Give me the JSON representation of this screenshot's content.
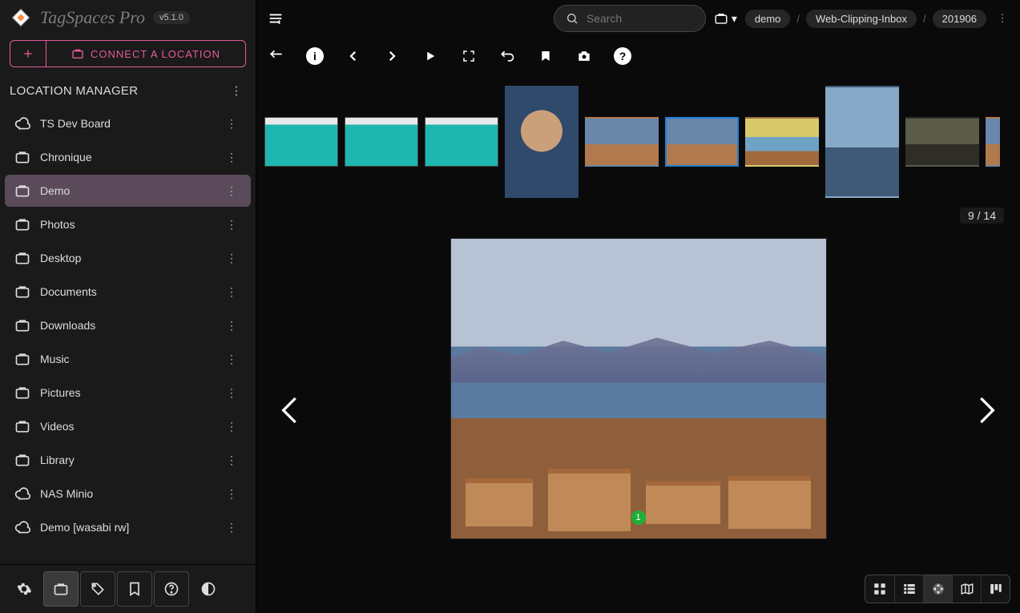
{
  "app": {
    "name": "TagSpaces Pro",
    "version": "v5.1.0"
  },
  "sidebar": {
    "connect_label": "CONNECT A LOCATION",
    "section_title": "LOCATION MANAGER",
    "locations": [
      {
        "name": "TS Dev Board",
        "icon": "cloud"
      },
      {
        "name": "Chronique",
        "icon": "briefcase"
      },
      {
        "name": "Demo",
        "icon": "briefcase",
        "selected": true
      },
      {
        "name": "Photos",
        "icon": "briefcase"
      },
      {
        "name": "Desktop",
        "icon": "briefcase"
      },
      {
        "name": "Documents",
        "icon": "briefcase"
      },
      {
        "name": "Downloads",
        "icon": "briefcase"
      },
      {
        "name": "Music",
        "icon": "briefcase"
      },
      {
        "name": "Pictures",
        "icon": "briefcase"
      },
      {
        "name": "Videos",
        "icon": "briefcase"
      },
      {
        "name": "Library",
        "icon": "briefcase"
      },
      {
        "name": "NAS Minio",
        "icon": "cloud"
      },
      {
        "name": "Demo [wasabi rw]",
        "icon": "cloud"
      }
    ]
  },
  "topbar": {
    "search_placeholder": "Search",
    "breadcrumbs": [
      "demo",
      "Web-Clipping-Inbox",
      "201906"
    ]
  },
  "viewer": {
    "counter": "9 / 14",
    "badge": "1",
    "thumbs": [
      {
        "kind": "screenshot"
      },
      {
        "kind": "screenshot"
      },
      {
        "kind": "screenshot"
      },
      {
        "kind": "portrait",
        "tall": true
      },
      {
        "kind": "painting"
      },
      {
        "kind": "painting",
        "selected": true
      },
      {
        "kind": "room"
      },
      {
        "kind": "window",
        "tall": true
      },
      {
        "kind": "dark"
      },
      {
        "kind": "painting",
        "partial": true
      }
    ]
  }
}
